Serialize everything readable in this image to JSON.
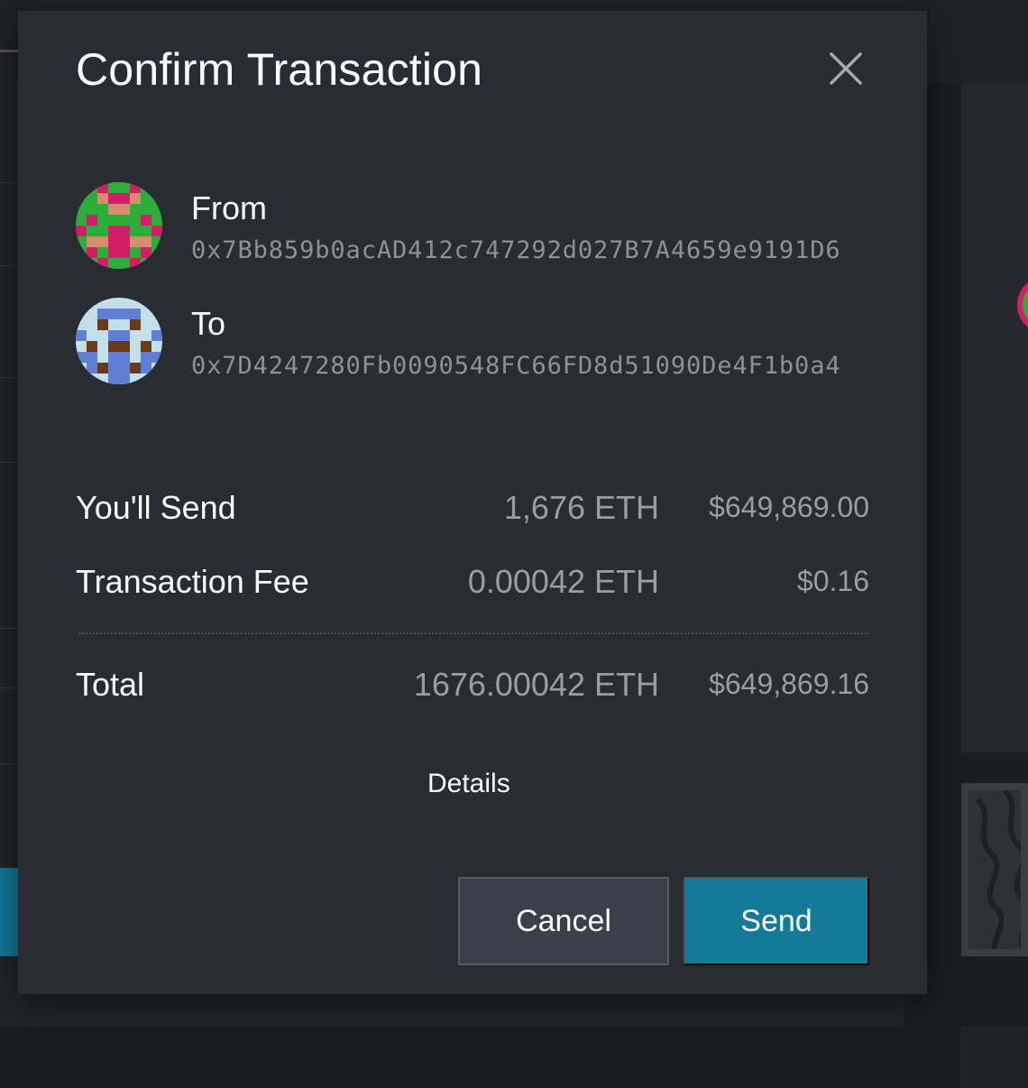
{
  "modal": {
    "title": "Confirm Transaction",
    "from": {
      "label": "From",
      "address": "0x7Bb859b0acAD412c747292d027B7A4659e9191D6"
    },
    "to": {
      "label": "To",
      "address": "0x7D4247280Fb0090548FC66FD8d51090De4F1b0a4"
    },
    "rows": [
      {
        "label": "You'll Send",
        "eth": "1,676 ETH",
        "usd": "$649,869.00"
      },
      {
        "label": "Transaction Fee",
        "eth": "0.00042 ETH",
        "usd": "$0.16"
      }
    ],
    "total": {
      "label": "Total",
      "eth": "1676.00042 ETH",
      "usd": "$649,869.16"
    },
    "details_label": "Details",
    "cancel_label": "Cancel",
    "send_label": "Send"
  },
  "colors": {
    "modal_bg": "#292c32",
    "accent": "#137a9a",
    "from_avatar_primary": "#2dae3b",
    "from_avatar_secondary": "#d21d67",
    "from_avatar_tertiary": "#d58f6e",
    "to_avatar_primary": "#c3e0ea",
    "to_avatar_secondary": "#5f7fd2",
    "to_avatar_tertiary": "#6b3a1e"
  },
  "icons": {
    "close": "close-icon",
    "from_avatar": "identicon",
    "to_avatar": "identicon"
  }
}
